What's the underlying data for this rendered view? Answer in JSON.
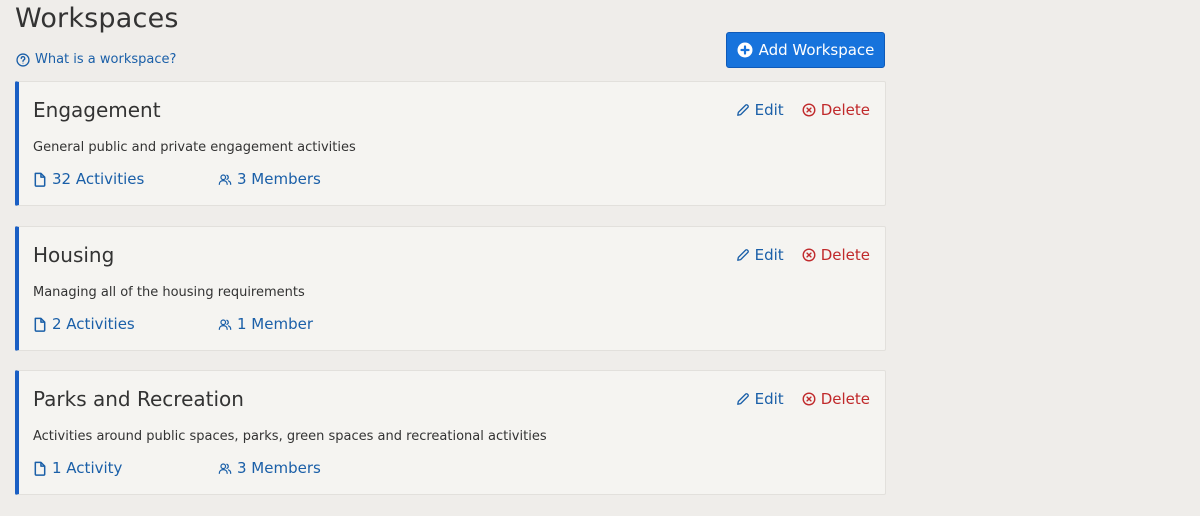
{
  "header": {
    "title": "Workspaces",
    "help_link": "What is a workspace?",
    "add_button": "Add Workspace"
  },
  "colors": {
    "accent": "#1773dc",
    "link": "#1a5fa8",
    "danger": "#c0292b",
    "card_border_accent": "#1a5fc4"
  },
  "actions": {
    "edit": "Edit",
    "delete": "Delete"
  },
  "workspaces": [
    {
      "name": "Engagement",
      "description": "General public and private engagement activities",
      "activities": "32 Activities",
      "members": "3 Members"
    },
    {
      "name": "Housing",
      "description": "Managing all of the housing requirements",
      "activities": "2 Activities",
      "members": "1 Member"
    },
    {
      "name": "Parks and Recreation",
      "description": "Activities around public spaces, parks, green spaces and recreational activities",
      "activities": "1 Activity",
      "members": "3 Members"
    }
  ]
}
